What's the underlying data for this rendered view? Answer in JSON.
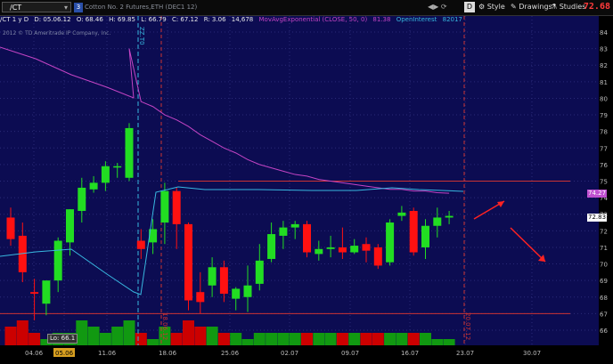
{
  "toolbar": {
    "symbol": "/CT",
    "symbol_badge": "3",
    "description": "Cotton No. 2 Futures,ETH (DEC1 12)",
    "buttons": [
      {
        "name": "settings",
        "label": "D"
      },
      {
        "name": "style",
        "label": "Style"
      },
      {
        "name": "drawings",
        "label": "Drawings"
      },
      {
        "name": "studies",
        "label": "Studies"
      }
    ],
    "last_price": "72.68",
    "last_price_color": "#ff3b3b"
  },
  "info": {
    "period": "/CT 1 y D",
    "date": "D: 05.06.12",
    "open": "O: 68.46",
    "high": "H: 69.85",
    "low": "L: 66.79",
    "close": "C: 67.12",
    "range": "R: 3.06",
    "volume": "14,678",
    "ema_label": "MovAvgExponential (CLOSE, 50, 0)",
    "ema_value": "81.38",
    "oi_label": "OpenInterest",
    "oi_value": "82017"
  },
  "copyright": "2012 © TD Ameritrade IP Company, Inc.",
  "vline_labels": {
    "v1": "ZZ.T0",
    "v2": "18.06.12",
    "v3": "20.07.12"
  },
  "low_tag": "Lo: 66.1",
  "price_tags": [
    {
      "value": "74.27",
      "color": "#c050d0"
    },
    {
      "value": "72.83",
      "color": "#ffffff"
    },
    {
      "value": "72.68",
      "color": "#ff3b3b"
    }
  ],
  "colors": {
    "background": "#0c0c52",
    "up": "#22dd22",
    "down": "#ff1111",
    "ema": "#c444c4",
    "oi": "#38b8e0",
    "hline": "#cc3333",
    "vol_up": "#119911",
    "vol_down": "#cc0000"
  },
  "chart_data": {
    "type": "candlestick",
    "y_ticks": [
      84,
      83,
      82,
      81,
      80,
      79,
      78,
      77,
      76,
      75,
      74,
      73,
      72,
      71,
      70,
      69,
      68,
      67,
      66
    ],
    "x_ticks": [
      "04.06",
      "05.06",
      "11.06",
      "18.06",
      "25.06",
      "02.07",
      "09.07",
      "16.07",
      "23.07",
      "30.07"
    ],
    "highlighted_x_tick": "05.06",
    "candles": [
      {
        "o": 72.8,
        "h": 73.4,
        "c": 71.5,
        "l": 71.1
      },
      {
        "o": 71.7,
        "h": 72.5,
        "c": 69.5,
        "l": 68.9
      },
      {
        "o": 68.3,
        "h": 69.1,
        "c": 68.2,
        "l": 66.6
      },
      {
        "o": 67.6,
        "h": 68.4,
        "c": 69.0,
        "l": 66.9
      },
      {
        "o": 69.0,
        "h": 71.6,
        "c": 71.4,
        "l": 68.3
      },
      {
        "o": 71.3,
        "h": 73.3,
        "c": 73.3,
        "l": 70.5
      },
      {
        "o": 73.2,
        "h": 75.2,
        "c": 74.6,
        "l": 72.5
      },
      {
        "o": 74.5,
        "h": 75.3,
        "c": 74.9,
        "l": 74.3
      },
      {
        "o": 74.9,
        "h": 76.2,
        "c": 75.9,
        "l": 74.4
      },
      {
        "o": 75.9,
        "h": 76.1,
        "c": 75.9,
        "l": 75.2
      },
      {
        "o": 75.2,
        "h": 78.5,
        "c": 78.2,
        "l": 75.0
      },
      {
        "o": 71.4,
        "h": 72.1,
        "c": 70.9,
        "l": 70.3
      },
      {
        "o": 71.3,
        "h": 72.7,
        "c": 72.1,
        "l": 70.6
      },
      {
        "o": 72.5,
        "h": 74.9,
        "c": 74.4,
        "l": 71.2
      },
      {
        "o": 74.4,
        "h": 74.6,
        "c": 72.4,
        "l": 70.9
      },
      {
        "o": 72.4,
        "h": 72.5,
        "c": 67.8,
        "l": 67.2
      },
      {
        "o": 68.3,
        "h": 69.5,
        "c": 67.7,
        "l": 67.0
      },
      {
        "o": 68.7,
        "h": 70.4,
        "c": 69.8,
        "l": 68.0
      },
      {
        "o": 69.8,
        "h": 70.2,
        "c": 68.2,
        "l": 67.7
      },
      {
        "o": 67.9,
        "h": 68.6,
        "c": 68.5,
        "l": 67.2
      },
      {
        "o": 68.0,
        "h": 69.9,
        "c": 68.7,
        "l": 67.1
      },
      {
        "o": 68.8,
        "h": 71.2,
        "c": 70.2,
        "l": 68.4
      },
      {
        "o": 70.3,
        "h": 72.5,
        "c": 71.8,
        "l": 70.1
      },
      {
        "o": 71.7,
        "h": 72.6,
        "c": 72.2,
        "l": 70.9
      },
      {
        "o": 72.2,
        "h": 72.6,
        "c": 72.4,
        "l": 71.5
      },
      {
        "o": 72.4,
        "h": 72.6,
        "c": 70.7,
        "l": 70.4
      },
      {
        "o": 70.6,
        "h": 71.4,
        "c": 70.9,
        "l": 70.2
      },
      {
        "o": 70.9,
        "h": 71.7,
        "c": 71.0,
        "l": 70.4
      },
      {
        "o": 71.0,
        "h": 72.2,
        "c": 70.7,
        "l": 70.3
      },
      {
        "o": 70.7,
        "h": 71.5,
        "c": 71.1,
        "l": 70.6
      },
      {
        "o": 71.2,
        "h": 71.6,
        "c": 70.8,
        "l": 70.1
      },
      {
        "o": 71.0,
        "h": 71.2,
        "c": 69.9,
        "l": 69.7
      },
      {
        "o": 70.1,
        "h": 72.7,
        "c": 72.5,
        "l": 69.9
      },
      {
        "o": 72.9,
        "h": 73.5,
        "c": 73.1,
        "l": 72.6
      },
      {
        "o": 73.2,
        "h": 73.4,
        "c": 70.7,
        "l": 70.5
      },
      {
        "o": 71.0,
        "h": 72.7,
        "c": 72.3,
        "l": 70.3
      },
      {
        "o": 72.3,
        "h": 73.4,
        "c": 72.8,
        "l": 71.6
      },
      {
        "o": 72.8,
        "h": 73.2,
        "c": 72.9,
        "l": 72.4
      }
    ],
    "volume": [
      3,
      4,
      2,
      1,
      2,
      2,
      4,
      3,
      2,
      3,
      4,
      2,
      1,
      3,
      2,
      4,
      3,
      3,
      2,
      2,
      1,
      2,
      2,
      2,
      2,
      2,
      2,
      2,
      2,
      2,
      2,
      2,
      2,
      2,
      2,
      2,
      1,
      1
    ],
    "ema": [
      null,
      null,
      null,
      null,
      null,
      null,
      null,
      null,
      null,
      null,
      83.0,
      79.8,
      79.5,
      79.0,
      78.7,
      78.3,
      77.8,
      77.4,
      77.0,
      76.7,
      76.3,
      76.0,
      75.8,
      75.6,
      75.4,
      75.3,
      75.1,
      75.0,
      74.9,
      74.8,
      74.7,
      74.6,
      74.5,
      74.5,
      74.4,
      74.4,
      74.3,
      74.27
    ],
    "hlines": [
      75.0,
      67.0
    ]
  }
}
